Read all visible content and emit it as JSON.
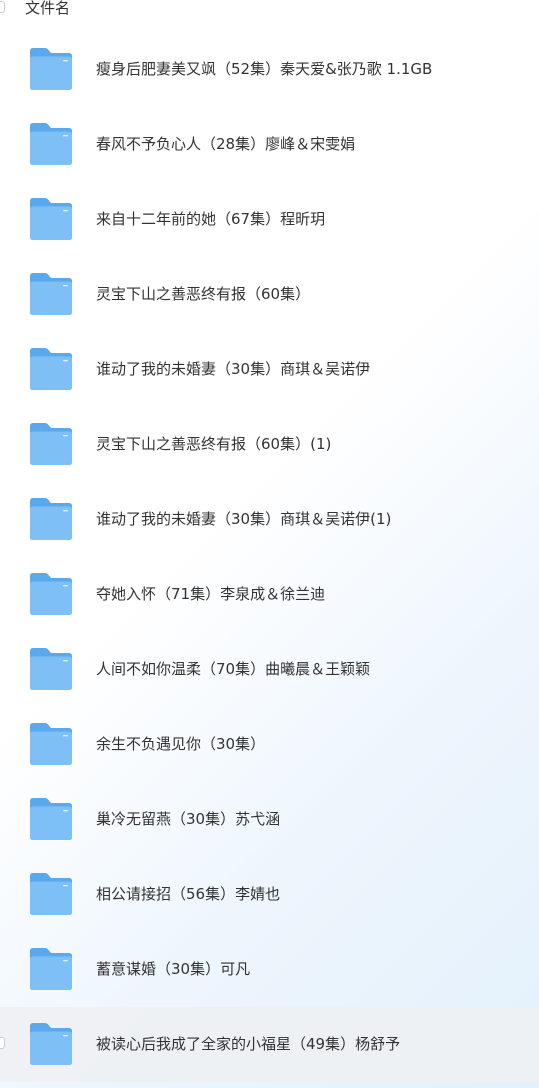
{
  "header": {
    "column_label": "文件名"
  },
  "folders": [
    {
      "name": "瘦身后肥妻美又飒（52集）秦天爱&张乃歌 1.1GB",
      "icon": "folder-icon"
    },
    {
      "name": "春风不予负心人（28集）廖峰＆宋雯娟",
      "icon": "folder-icon"
    },
    {
      "name": "来自十二年前的她（67集）程昕玥",
      "icon": "folder-icon"
    },
    {
      "name": "灵宝下山之善恶终有报（60集）",
      "icon": "folder-icon"
    },
    {
      "name": "谁动了我的未婚妻（30集）商琪＆吴诺伊",
      "icon": "folder-icon"
    },
    {
      "name": "灵宝下山之善恶终有报（60集）(1)",
      "icon": "folder-icon"
    },
    {
      "name": "谁动了我的未婚妻（30集）商琪＆吴诺伊(1)",
      "icon": "folder-icon"
    },
    {
      "name": "夺她入怀（71集）李泉成＆徐兰迪",
      "icon": "folder-icon"
    },
    {
      "name": "人间不如你温柔（70集）曲曦晨＆王颖颖",
      "icon": "folder-icon"
    },
    {
      "name": "余生不负遇见你（30集）",
      "icon": "folder-icon"
    },
    {
      "name": "巢冷无留燕（30集）苏弋涵",
      "icon": "folder-icon"
    },
    {
      "name": "相公请接招（56集）李婧也",
      "icon": "folder-icon"
    },
    {
      "name": "蓄意谋婚（30集）可凡",
      "icon": "folder-icon"
    },
    {
      "name": "被读心后我成了全家的小福星（49集）杨舒予",
      "icon": "folder-icon"
    }
  ],
  "colors": {
    "folder_back": "#5aa9ec",
    "folder_front": "#7ec0f5",
    "hover_row": "#eef0f3",
    "text": "#333333"
  }
}
